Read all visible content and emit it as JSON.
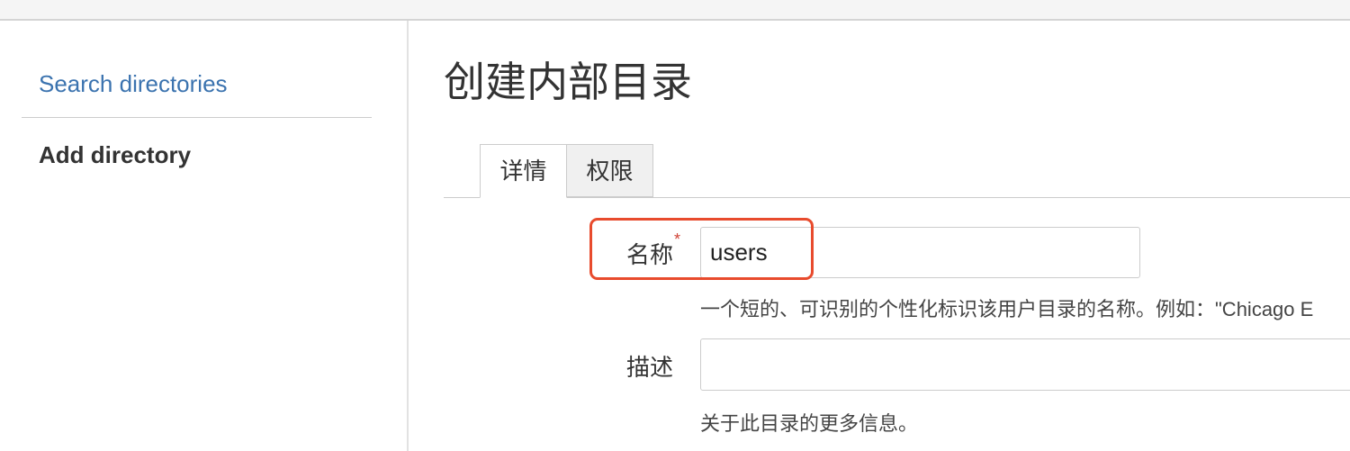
{
  "sidebar": {
    "search_link": "Search directories",
    "add_directory": "Add directory"
  },
  "main": {
    "title": "创建内部目录",
    "tabs": [
      {
        "label": "详情",
        "active": true
      },
      {
        "label": "权限",
        "active": false
      }
    ],
    "form": {
      "name": {
        "label": "名称",
        "required_marker": "*",
        "value": "users",
        "help": "一个短的、可识别的个性化标识该用户目录的名称。例如：\"Chicago E"
      },
      "description": {
        "label": "描述",
        "value": "",
        "help": "关于此目录的更多信息。"
      }
    }
  },
  "colors": {
    "link": "#3b73af",
    "required": "#d04437",
    "highlight": "#e84b2d",
    "inactive_tab": "#f0f0f0"
  }
}
